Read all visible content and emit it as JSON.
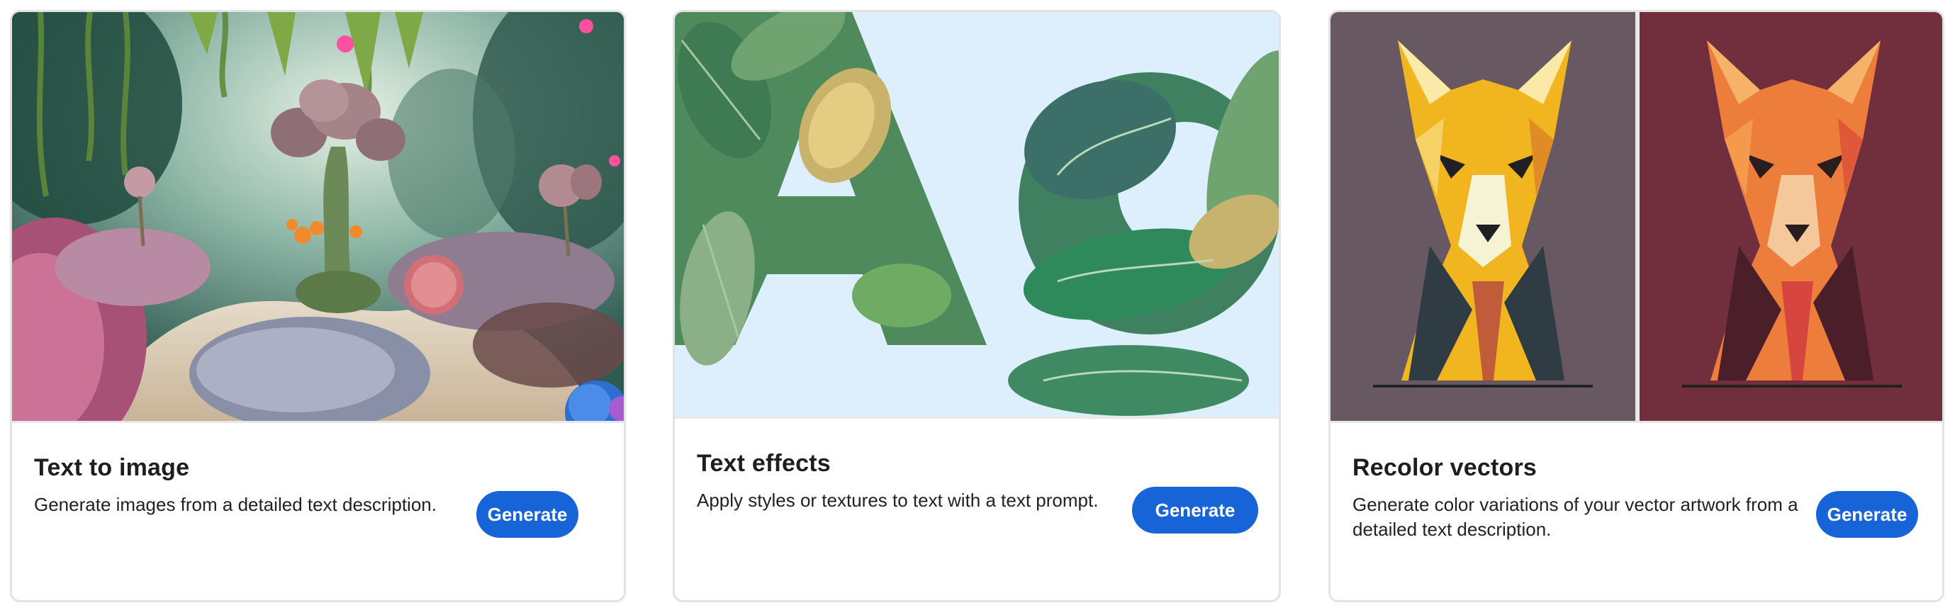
{
  "cards": [
    {
      "title": "Text to image",
      "description": "Generate images from a detailed text description.",
      "button_label": "Generate",
      "image": "fantasy-garden-image"
    },
    {
      "title": "Text effects",
      "description": "Apply styles or textures to text with a text prompt.",
      "button_label": "Generate",
      "image": "leafy-letters-image"
    },
    {
      "title": "Recolor vectors",
      "description": "Generate color variations of your vector artwork from a detailed text description.",
      "button_label": "Generate",
      "image": "recolored-dog-vectors-image"
    }
  ],
  "colors": {
    "button": "#1764d9",
    "card_border": "#e3e3e3",
    "text_effects_bg": "#ddeefc",
    "recolor_left_bg": "#675861",
    "recolor_right_bg": "#712f3e"
  }
}
